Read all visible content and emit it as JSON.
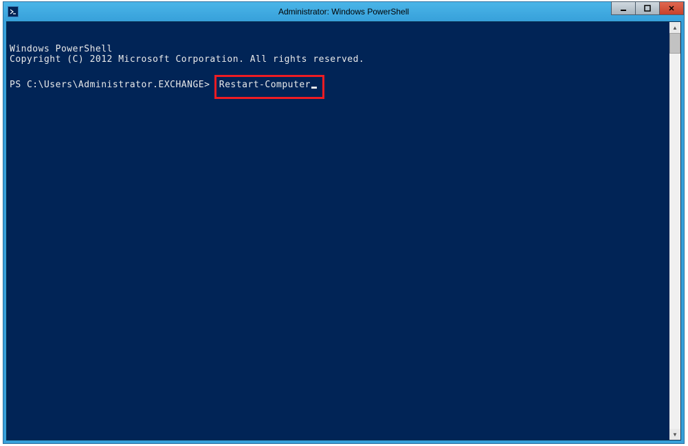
{
  "window": {
    "title": "Administrator: Windows PowerShell"
  },
  "console": {
    "line1": "Windows PowerShell",
    "line2": "Copyright (C) 2012 Microsoft Corporation. All rights reserved.",
    "prompt": "PS C:\\Users\\Administrator.EXCHANGE>",
    "command": "Restart-Computer"
  },
  "buttons": {
    "minimize": "–",
    "maximize": "◻",
    "close": "✕"
  },
  "scroll": {
    "up": "▲",
    "down": "▼"
  }
}
